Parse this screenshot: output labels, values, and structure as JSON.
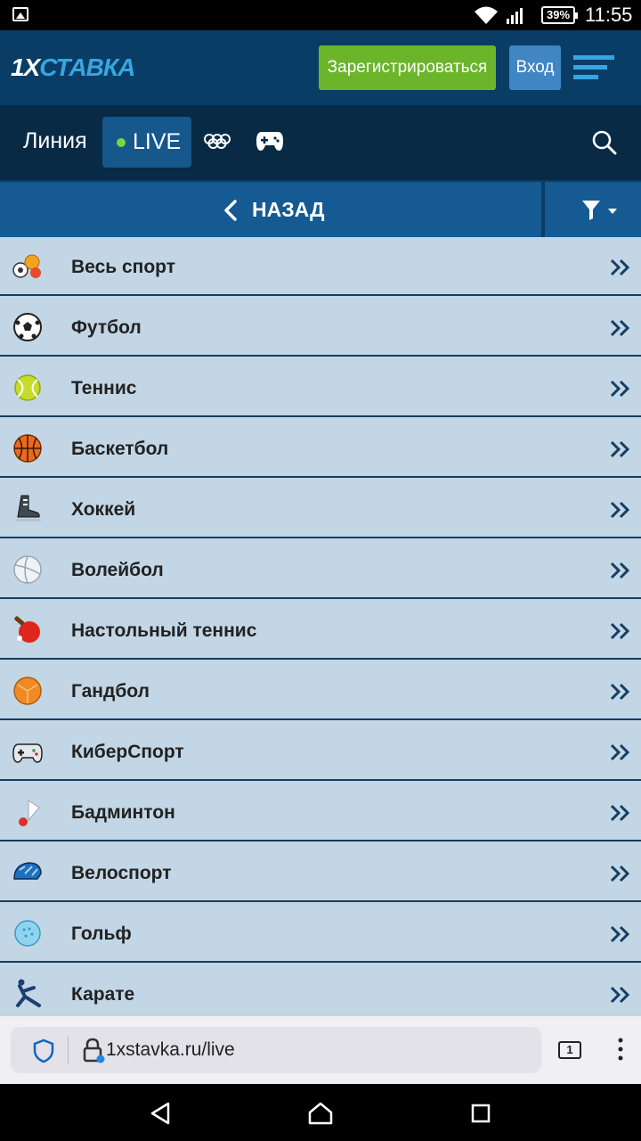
{
  "status_bar": {
    "battery": "39%",
    "time": "11:55"
  },
  "header": {
    "logo_prefix": "1X",
    "logo_main": "СТАВКА",
    "register_label": "Зарегистрироваться",
    "login_label": "Вход",
    "colors": {
      "header_bg": "#0a3d66",
      "register_bg": "#6bb52a",
      "login_bg": "#3f86c3"
    }
  },
  "nav": {
    "line_label": "Линия",
    "live_label": "LIVE",
    "icons": [
      "olympic-rings-icon",
      "gamepad-icon",
      "search-icon"
    ]
  },
  "back_bar": {
    "back_label": "НАЗАД",
    "filter_icon": "filter-icon"
  },
  "sports": [
    {
      "label": "Весь спорт",
      "icon": "all-sports-icon"
    },
    {
      "label": "Футбол",
      "icon": "soccer-ball-icon"
    },
    {
      "label": "Теннис",
      "icon": "tennis-ball-icon"
    },
    {
      "label": "Баскетбол",
      "icon": "basketball-icon"
    },
    {
      "label": "Хоккей",
      "icon": "hockey-skate-icon"
    },
    {
      "label": "Волейбол",
      "icon": "volleyball-icon"
    },
    {
      "label": "Настольный теннис",
      "icon": "ping-pong-icon"
    },
    {
      "label": "Гандбол",
      "icon": "handball-icon"
    },
    {
      "label": "КиберСпорт",
      "icon": "gamepad-icon"
    },
    {
      "label": "Бадминтон",
      "icon": "shuttlecock-icon"
    },
    {
      "label": "Велоспорт",
      "icon": "bike-helmet-icon"
    },
    {
      "label": "Гольф",
      "icon": "golf-ball-icon"
    },
    {
      "label": "Карате",
      "icon": "karate-icon"
    }
  ],
  "browser": {
    "url": "1xstavka.ru/live",
    "tab_count": "1"
  }
}
